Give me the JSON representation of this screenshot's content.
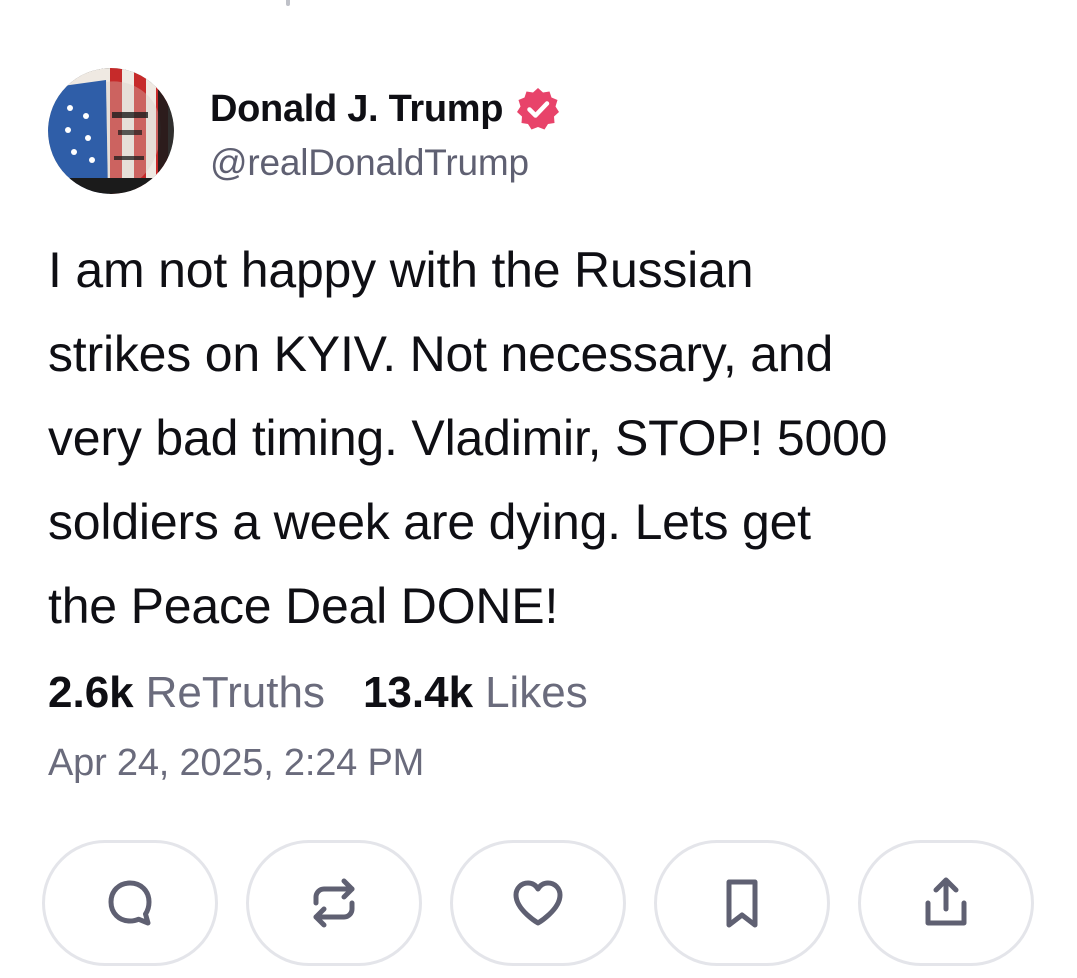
{
  "post": {
    "author": {
      "display_name": "Donald J. Trump",
      "handle": "@realDonaldTrump",
      "verified": true,
      "avatar_icon": "avatar-flag-portrait",
      "badge_color": "#e8436a"
    },
    "text_lines": [
      "I am not happy with the Russian",
      "strikes on KYIV. Not necessary, and",
      "very bad timing. Vladimir, STOP! 5000",
      "soldiers a week are dying. Lets get",
      "the Peace Deal DONE!"
    ],
    "stats": {
      "retruths_count": "2.6k",
      "retruths_label": "ReTruths",
      "likes_count": "13.4k",
      "likes_label": "Likes"
    },
    "timestamp": "Apr 24, 2025, 2:24 PM",
    "actions": [
      {
        "name": "reply",
        "icon": "comment-bubble-icon"
      },
      {
        "name": "retruth",
        "icon": "repost-arrows-icon"
      },
      {
        "name": "like",
        "icon": "heart-icon"
      },
      {
        "name": "bookmark",
        "icon": "bookmark-icon"
      },
      {
        "name": "share",
        "icon": "share-icon"
      }
    ],
    "colors": {
      "text_primary": "#0f0f14",
      "text_secondary": "#6a6b7c",
      "icon_color": "#5f6072",
      "button_border": "#e4e5ea"
    }
  }
}
